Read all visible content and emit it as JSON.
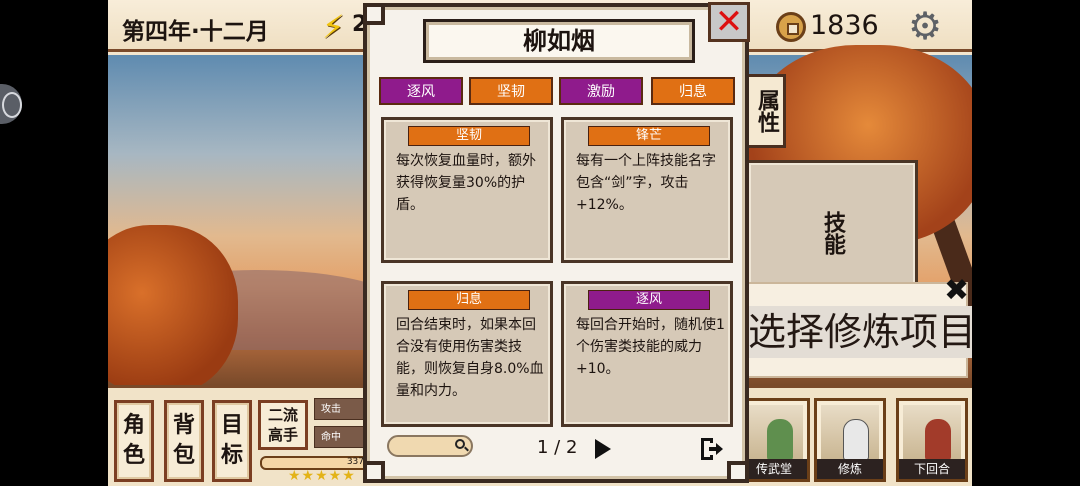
{
  "header": {
    "date": "第四年·十二月",
    "energy": "2",
    "money": "1836"
  },
  "side_tabs": {
    "attributes": "属性",
    "skills": "技能"
  },
  "training": {
    "label": "选择修炼项目"
  },
  "bottom": {
    "buttons": [
      {
        "line1": "角",
        "line2": "色"
      },
      {
        "line1": "背",
        "line2": "包"
      },
      {
        "line1": "目",
        "line2": "标"
      }
    ],
    "rank": {
      "line1": "二流",
      "line2": "高手"
    },
    "stats": {
      "attack": "攻击",
      "hit": "命中"
    },
    "hp": "337",
    "stars": "★★★★★",
    "cards": [
      {
        "label": "传武堂"
      },
      {
        "label": "修炼"
      },
      {
        "label": "下回合"
      }
    ]
  },
  "dialog": {
    "name": "柳如烟",
    "close": "✕",
    "tags": [
      {
        "label": "逐风",
        "color": "#8f1b8c"
      },
      {
        "label": "坚韧",
        "color": "#e07014"
      },
      {
        "label": "激励",
        "color": "#8f1b8c"
      },
      {
        "label": "归息",
        "color": "#e07014"
      }
    ],
    "skills": [
      {
        "title": "坚韧",
        "desc": "每次恢复血量时，额外获得恢复量30%的护盾。"
      },
      {
        "title": "锋芒",
        "desc": "每有一个上阵技能名字包含“剑”字，攻击+12%。"
      },
      {
        "title": "归息",
        "desc": "回合结束时，如果本回合没有使用伤害类技能，则恢复自身8.0%血量和内力。"
      },
      {
        "title": "逐风",
        "desc": "每回合开始时，随机使1个伤害类技能的威力+10。"
      }
    ],
    "page": "1 / 2"
  }
}
